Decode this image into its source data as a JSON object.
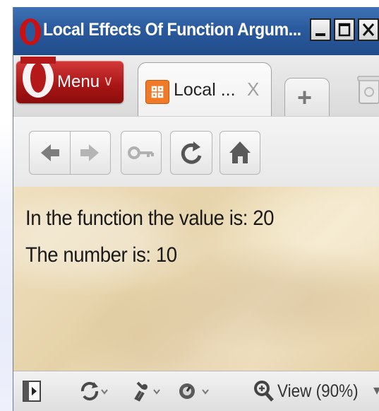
{
  "window": {
    "title": "Local Effects Of Function Argum...",
    "min_glyph": "_",
    "max_glyph": "□",
    "close_glyph": "X"
  },
  "menu": {
    "label": "Menu",
    "caret": "∨"
  },
  "tabs": [
    {
      "label": "Local ...",
      "close": "X",
      "icon": "page-favicon-icon",
      "active": true
    }
  ],
  "newtab": {
    "label": "+"
  },
  "nav": {
    "icons": [
      "back-arrow-icon",
      "forward-arrow-icon",
      "key-icon",
      "reload-icon",
      "home-icon"
    ]
  },
  "content": {
    "line1": "In the function the value is: 20",
    "line2": "The number is: 10"
  },
  "status": {
    "zoom_label": "View (90%)",
    "zoom_caret": "▾",
    "icons": [
      "panel-toggle-icon",
      "sync-icon",
      "tools-icon",
      "speed-dial-icon",
      "zoom-icon"
    ]
  },
  "colors": {
    "titlebar": "#2a5a9e",
    "menu_red": "#b21a1a",
    "page_bg": "#e9d7b2"
  }
}
